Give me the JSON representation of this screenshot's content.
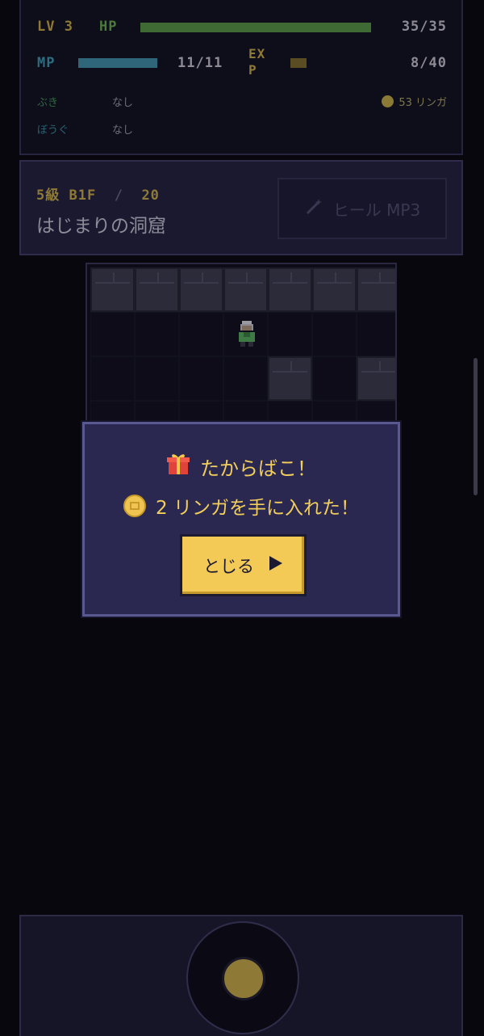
{
  "status": {
    "lv_label": "LV",
    "lv_value": "3",
    "hp_label": "HP",
    "hp_text": "35/35",
    "hp_fraction": 1.0,
    "mp_label": "MP",
    "mp_text": "11/11",
    "mp_fraction": 1.0,
    "exp_label": "EX P",
    "exp_text": "8/40",
    "exp_fraction": 0.2,
    "weapon_label": "ぶき",
    "weapon_value": "なし",
    "armor_label": "ぼうぐ",
    "armor_value": "なし",
    "gold_text": "53 リンガ"
  },
  "floor": {
    "rank": "5級",
    "floor_text": "B1F",
    "separator": "/",
    "total": "20",
    "dungeon_name": "はじまりの洞窟",
    "heal_button": "ヒール MP3",
    "heal_icon": "magic-wand-icon"
  },
  "dialog": {
    "title": "たからばこ！",
    "title_icon": "gift-icon",
    "message": "2 リンガを手に入れた！",
    "message_icon": "coin-icon",
    "close_label": "とじる",
    "close_icon": "play-arrow-icon"
  },
  "colors": {
    "background": "#08070e",
    "accent_gold": "#f2ce5c",
    "dialog_bg": "#2a2850",
    "hp": "#3f6a34",
    "mp": "#30667a"
  }
}
